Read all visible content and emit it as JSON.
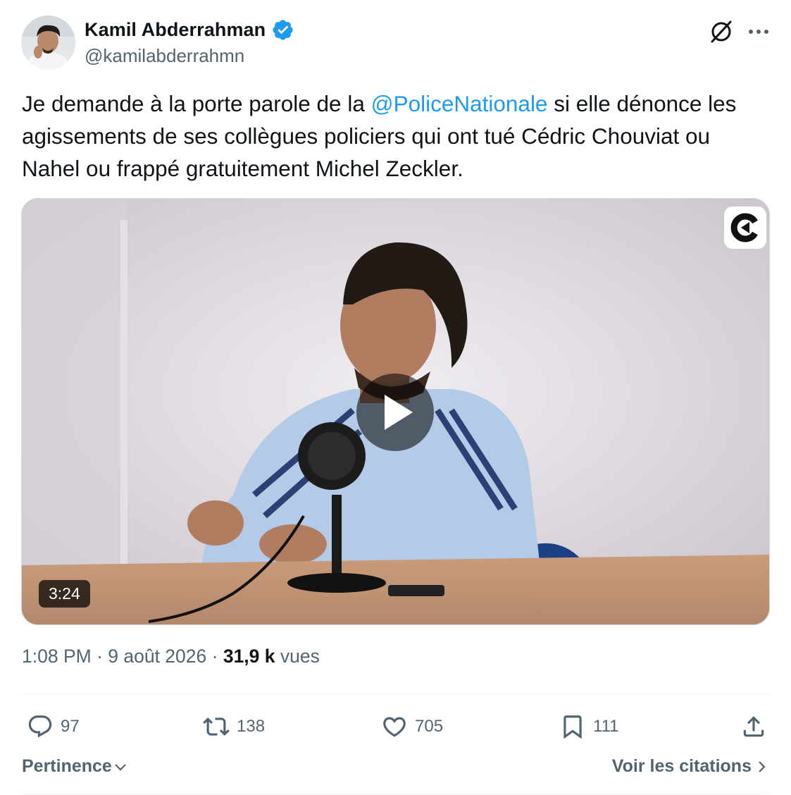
{
  "author": {
    "name": "Kamil Abderrahman",
    "handle": "@kamilabderrahmn",
    "verified": true
  },
  "tweet": {
    "text_before": "Je demande à la porte parole de la ",
    "mention": "@PoliceNationale",
    "text_after": " si elle dénonce les agissements de ses collègues policiers qui ont tué Cédric Chouviat ou Nahel ou frappé gratuitement Michel Zeckler."
  },
  "media": {
    "duration": "3:24",
    "icons": [
      "play-icon",
      "brand-logo-icon"
    ]
  },
  "meta": {
    "time": "1:08 PM",
    "separator": " · ",
    "date": "9 août 2026",
    "views_count": "31,9 k",
    "views_label": " vues"
  },
  "actions": {
    "replies": "97",
    "reposts": "138",
    "likes": "705",
    "bookmarks": "111"
  },
  "footer": {
    "sort_label": "Pertinence",
    "quotes_label": "Voir les citations"
  },
  "colors": {
    "accent": "#1d9bf0",
    "secondary_text": "#536471",
    "primary_text": "#0f1419",
    "divider": "#eff3f4"
  }
}
